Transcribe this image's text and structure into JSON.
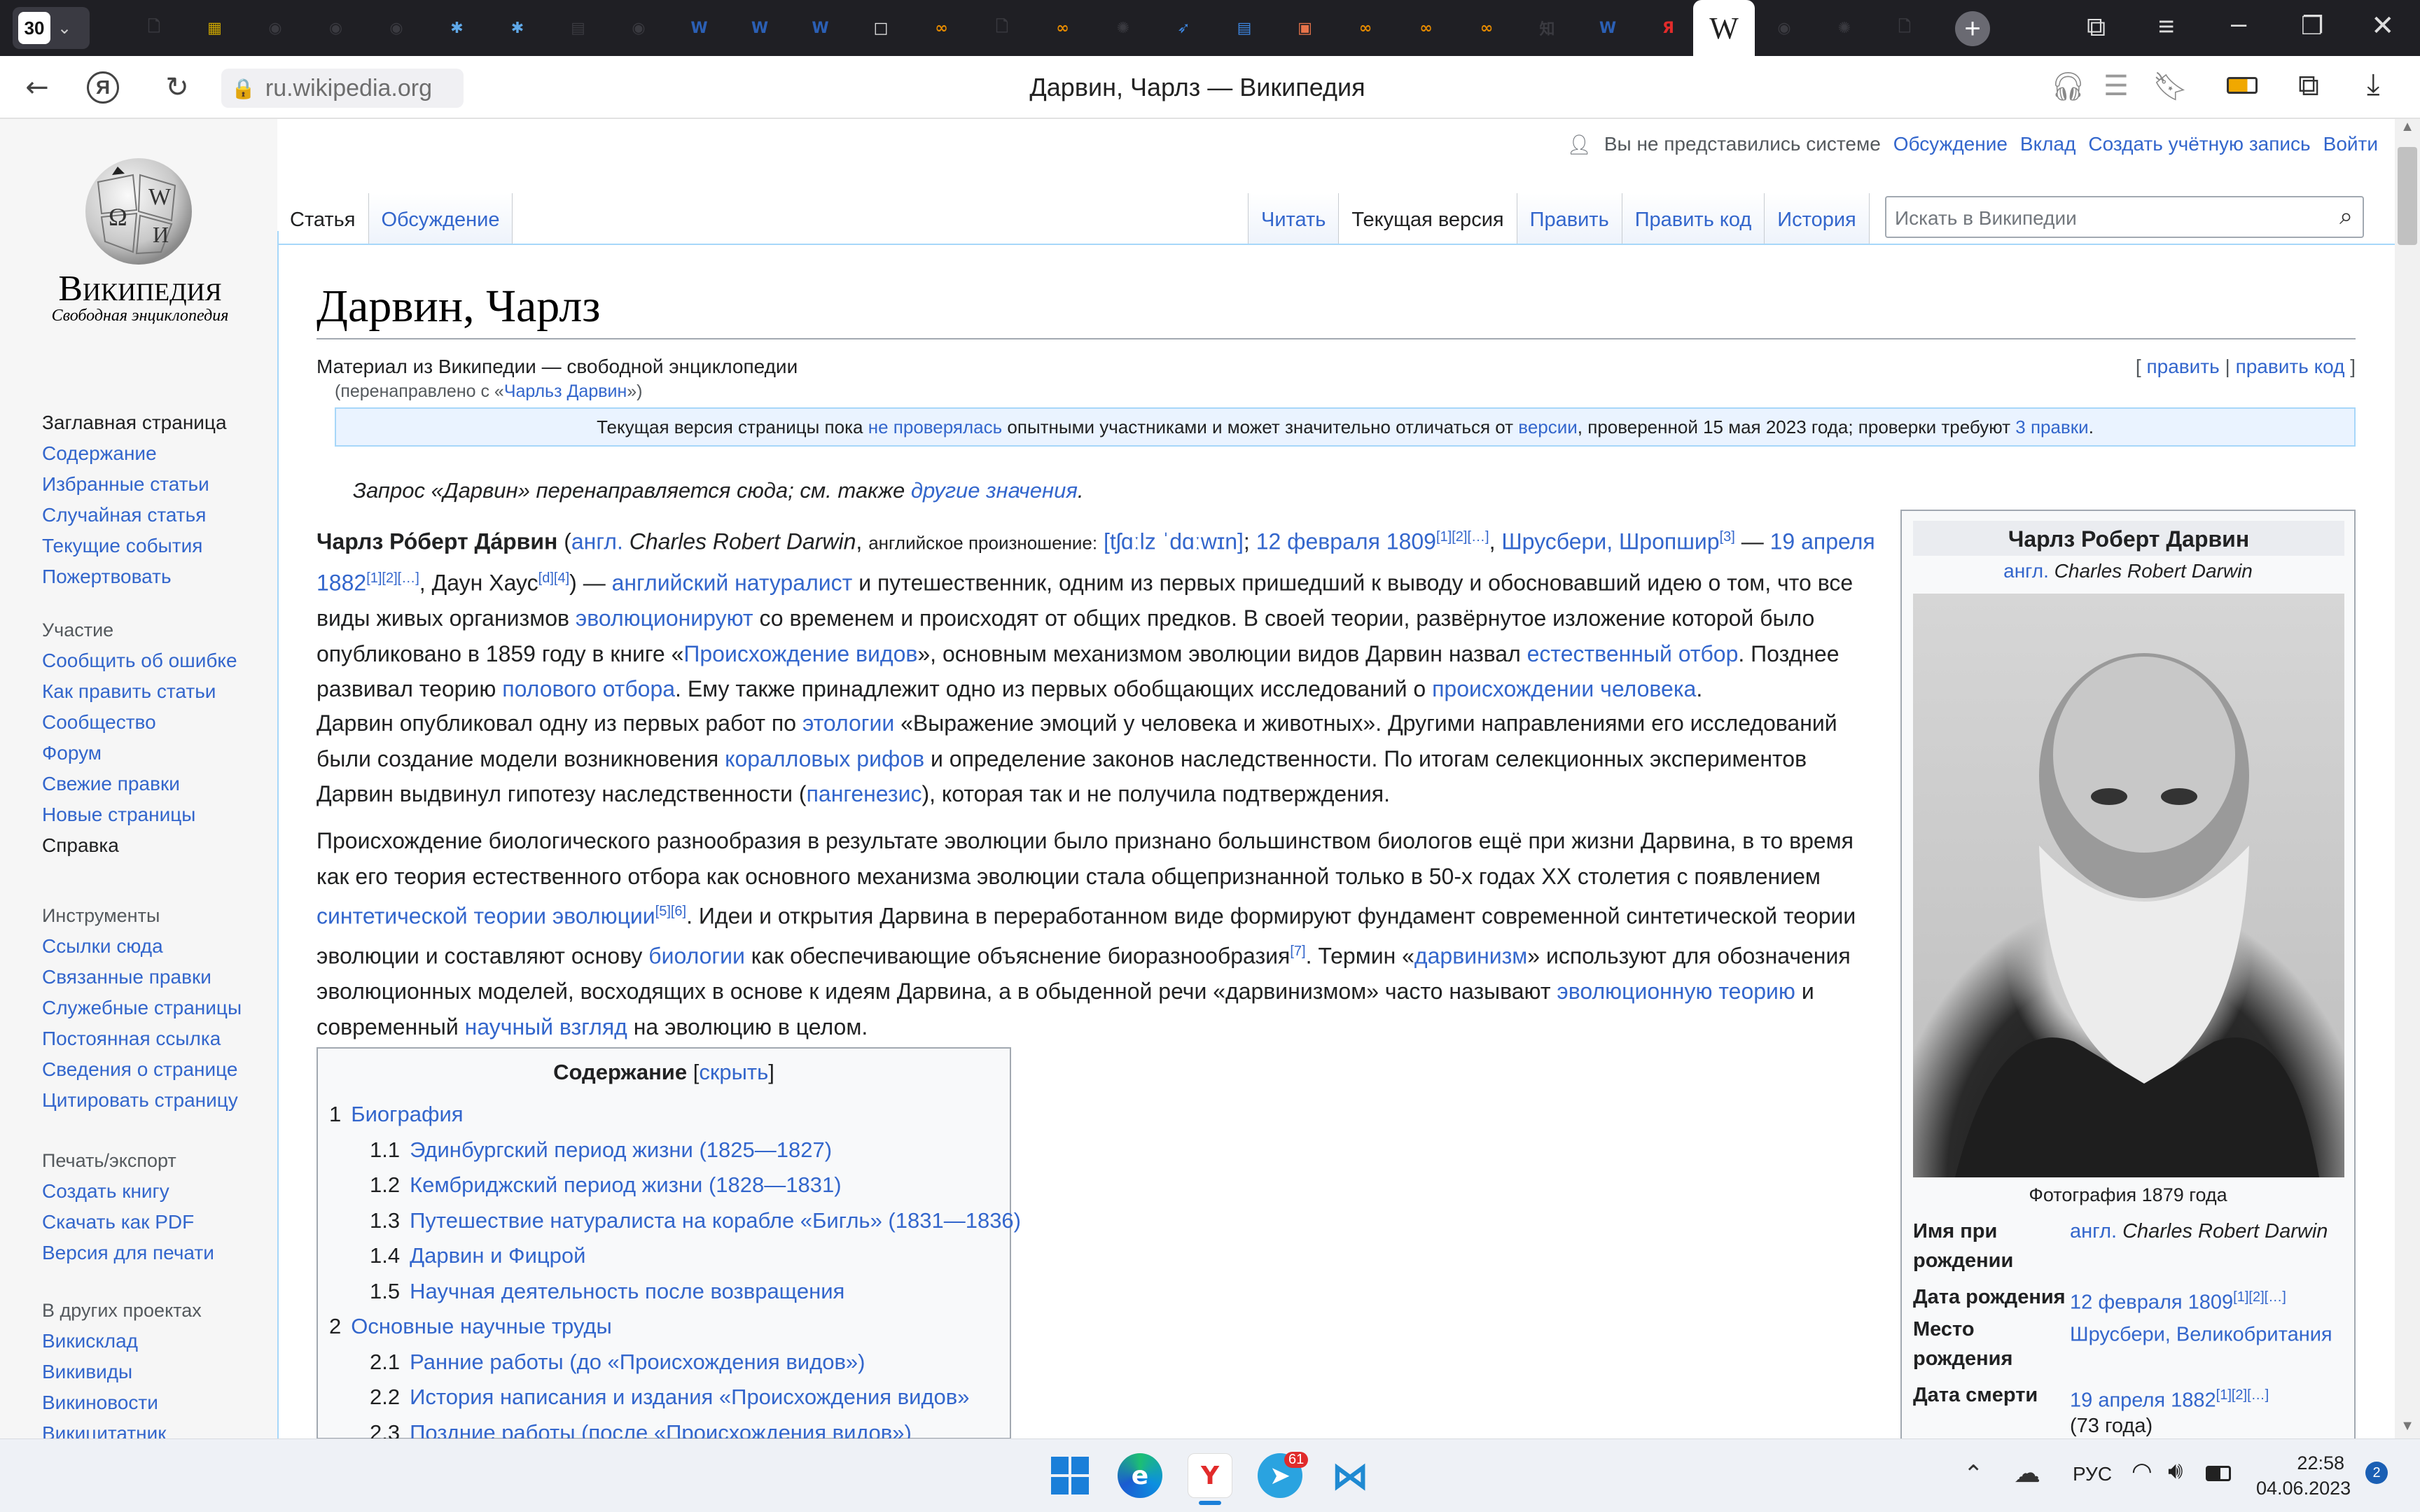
{
  "browser": {
    "tab_count": "30",
    "tabs": [
      {
        "icon": "doc-icon",
        "glyph": "🗋",
        "color": "#3a3a40"
      },
      {
        "icon": "yellow-app-icon",
        "glyph": "▦",
        "color": "#c9a300"
      },
      {
        "icon": "github-icon",
        "glyph": "◉",
        "color": "#3a3a40"
      },
      {
        "icon": "github-icon",
        "glyph": "◉",
        "color": "#3a3a40"
      },
      {
        "icon": "github-icon",
        "glyph": "◉",
        "color": "#3a3a40"
      },
      {
        "icon": "star-blue-icon",
        "glyph": "✱",
        "color": "#5fa8e8"
      },
      {
        "icon": "star-blue-icon",
        "glyph": "✱",
        "color": "#5fa8e8"
      },
      {
        "icon": "docs-icon",
        "glyph": "▤",
        "color": "#3a3a40"
      },
      {
        "icon": "github-icon",
        "glyph": "◉",
        "color": "#3a3a40"
      },
      {
        "icon": "word-icon",
        "glyph": "W",
        "color": "#2b5fb4"
      },
      {
        "icon": "word-icon",
        "glyph": "W",
        "color": "#2b5fb4"
      },
      {
        "icon": "word-icon",
        "glyph": "W",
        "color": "#2b5fb4"
      },
      {
        "icon": "blank-icon",
        "glyph": "□",
        "color": "#e8e8e8"
      },
      {
        "icon": "infinity-icon",
        "glyph": "∞",
        "color": "#e58a00"
      },
      {
        "icon": "doc-icon",
        "glyph": "🗋",
        "color": "#3a3a40"
      },
      {
        "icon": "infinity-icon",
        "glyph": "∞",
        "color": "#e58a00"
      },
      {
        "icon": "openai-icon",
        "glyph": "✺",
        "color": "#3a3a40"
      },
      {
        "icon": "feather-icon",
        "glyph": "➶",
        "color": "#3d86e0"
      },
      {
        "icon": "docs-icon",
        "glyph": "▤",
        "color": "#3d86e0"
      },
      {
        "icon": "slides-icon",
        "glyph": "▣",
        "color": "#e8744a"
      },
      {
        "icon": "infinity-icon",
        "glyph": "∞",
        "color": "#e58a00"
      },
      {
        "icon": "infinity-icon",
        "glyph": "∞",
        "color": "#e58a00"
      },
      {
        "icon": "infinity-icon",
        "glyph": "∞",
        "color": "#e58a00"
      },
      {
        "icon": "zhihu-icon",
        "glyph": "知",
        "color": "#3a3a40"
      },
      {
        "icon": "word-icon",
        "glyph": "W",
        "color": "#2b5fb4"
      },
      {
        "icon": "yandex-icon",
        "glyph": "Я",
        "color": "#e22b2b"
      }
    ],
    "active_tab_glyph": "W",
    "tabs_after": [
      {
        "icon": "github-icon",
        "glyph": "◉",
        "color": "#3a3a40"
      },
      {
        "icon": "openai-icon",
        "glyph": "✺",
        "color": "#3a3a40"
      },
      {
        "icon": "doc-icon",
        "glyph": "🗋",
        "color": "#3a3a40"
      }
    ],
    "url": "ru.wikipedia.org",
    "page_title": "Дарвин, Чарлз — Википедия"
  },
  "wiki": {
    "logo_name": "Википедия",
    "logo_tagline": "Свободная энциклопедия",
    "personal": [
      "Вы не представились системе",
      "Обсуждение",
      "Вклад",
      "Создать учётную запись",
      "Войти"
    ],
    "nav_main": [
      "Заглавная страница",
      "Содержание",
      "Избранные статьи",
      "Случайная статья",
      "Текущие события",
      "Пожертвовать"
    ],
    "participation": {
      "heading": "Участие",
      "items": [
        "Сообщить об ошибке",
        "Как править статьи",
        "Сообщество",
        "Форум",
        "Свежие правки",
        "Новые страницы",
        "Справка"
      ]
    },
    "tools": {
      "heading": "Инструменты",
      "items": [
        "Ссылки сюда",
        "Связанные правки",
        "Служебные страницы",
        "Постоянная ссылка",
        "Сведения о странице",
        "Цитировать страницу"
      ]
    },
    "print": {
      "heading": "Печать/экспорт",
      "items": [
        "Создать книгу",
        "Скачать как PDF",
        "Версия для печати"
      ]
    },
    "other": {
      "heading": "В других проектах",
      "items": [
        "Викисклад",
        "Викивиды",
        "Викиновости",
        "Викицитатник"
      ]
    },
    "tabs_left": [
      "Статья",
      "Обсуждение"
    ],
    "tabs_right": [
      "Читать",
      "Текущая версия",
      "Править",
      "Править код",
      "История"
    ],
    "search_placeholder": "Искать в Википедии",
    "title": "Дарвин, Чарлз",
    "from": "Материал из Википедии — свободной энциклопедии",
    "redirect_prefix": "(перенаправлено с «",
    "redirect_link": "Чарльз Дарвин",
    "redirect_suffix": "»)",
    "edit_links": [
      "править",
      "править код"
    ],
    "banner": {
      "t1": "Текущая версия страницы пока ",
      "l1": "не проверялась",
      "t2": " опытными участниками и может значительно отличаться от ",
      "l2": "версии",
      "t3": ", проверенной 15 мая 2023 года; проверки требуют ",
      "l3": "3 правки",
      "t4": "."
    },
    "hatnote": {
      "text": "Запрос «Дарвин» перенаправляется сюда; см. также ",
      "link": "другие значения",
      "end": "."
    },
    "toc": {
      "title": "Содержание",
      "hide": "скрыть",
      "items": [
        {
          "num": "1",
          "text": "Биография",
          "level": 1
        },
        {
          "num": "1.1",
          "text": "Эдинбургский период жизни (1825—1827)",
          "level": 2
        },
        {
          "num": "1.2",
          "text": "Кембриджский период жизни (1828—1831)",
          "level": 2
        },
        {
          "num": "1.3",
          "text": "Путешествие натуралиста на корабле «Бигль» (1831—1836)",
          "level": 2
        },
        {
          "num": "1.4",
          "text": "Дарвин и Фицрой",
          "level": 2
        },
        {
          "num": "1.5",
          "text": "Научная деятельность после возвращения",
          "level": 2
        },
        {
          "num": "2",
          "text": "Основные научные труды",
          "level": 1
        },
        {
          "num": "2.1",
          "text": "Ранние работы (до «Происхождения видов»)",
          "level": 2
        },
        {
          "num": "2.2",
          "text": "История написания и издания «Происхождения видов»",
          "level": 2
        },
        {
          "num": "2.3",
          "text": "Поздние работы (после «Происхождения видов»)",
          "level": 2
        }
      ]
    },
    "infobox": {
      "name": "Чарлз Роберт Дарвин",
      "eng_prefix": "англ.",
      "eng_name": "Charles Robert Darwin",
      "caption": "Фотография 1879 года",
      "rows": [
        {
          "label": "Имя при рождении",
          "link": "англ.",
          "value": "Charles Robert Darwin"
        },
        {
          "label": "Дата рождения",
          "link": "12 февраля 1809",
          "value": "[1][2][…]"
        },
        {
          "label": "Место рождения",
          "link": "Шрусбери, Великобритания",
          "value": ""
        },
        {
          "label": "Дата смерти",
          "link": "19 апреля 1882",
          "value": "[1][2][…]",
          "extra": "(73 года)"
        }
      ]
    }
  },
  "taskbar": {
    "time": "22:58",
    "date": "04.06.2023",
    "lang": "РУС",
    "notify": "2",
    "telegram_badge": "61"
  }
}
